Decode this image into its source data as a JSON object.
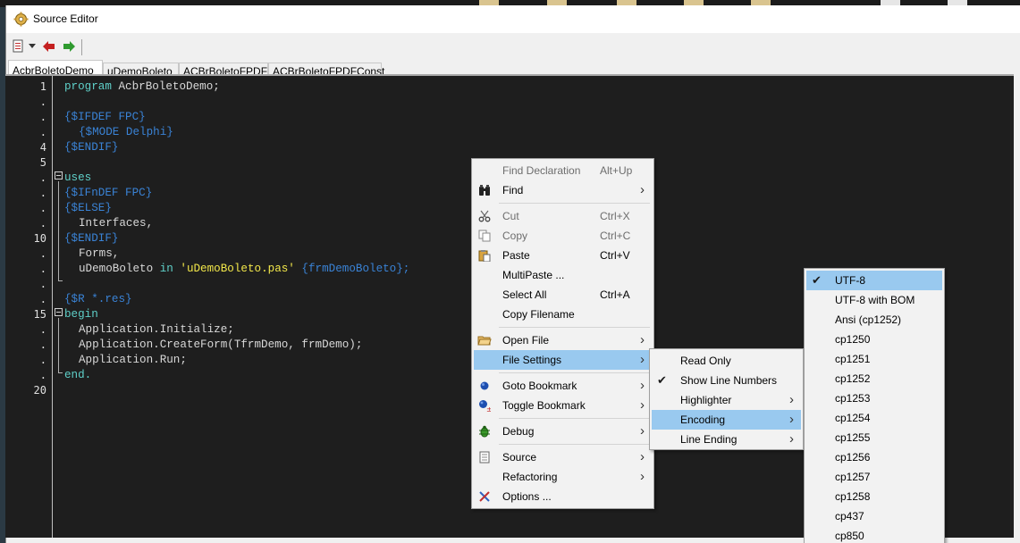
{
  "window": {
    "title": "Source Editor",
    "title_icon": "gear-app-icon"
  },
  "toolbar": {
    "icons": [
      "list-dropdown-icon",
      "back-arrow-icon",
      "forward-arrow-icon"
    ]
  },
  "tabs": [
    {
      "label": "AcbrBoletoDemo",
      "active": true
    },
    {
      "label": "uDemoBoleto",
      "active": false
    },
    {
      "label": "ACBrBoletoFPDF",
      "active": false
    },
    {
      "label": "ACBrBoletoFPDFConst",
      "active": false
    }
  ],
  "gutter": [
    "1",
    ".",
    ".",
    ".",
    "4",
    "5",
    ".",
    ".",
    ".",
    ".",
    "10",
    ".",
    ".",
    ".",
    ".",
    "15",
    ".",
    ".",
    ".",
    ".",
    "20"
  ],
  "code": {
    "line1": {
      "kw": "program",
      "rest": " AcbrBoletoDemo;"
    },
    "line3": "{$IFDEF FPC}",
    "line4": "{$MODE Delphi}",
    "line5": "{$ENDIF}",
    "line7": "uses",
    "line8": "{$IFnDEF FPC}",
    "line9": "{$ELSE}",
    "line10": "Interfaces,",
    "line11": "{$ENDIF}",
    "line12": "Forms,",
    "line13": {
      "a": "uDemoBoleto ",
      "kw": "in",
      "str": " 'uDemoBoleto.pas'",
      "dir": " {frmDemoBoleto};"
    },
    "line15": "{$R *.res}",
    "line16": "begin",
    "line17": "Application.Initialize;",
    "line18": "Application.CreateForm(TfrmDemo, frmDemo);",
    "line19": "Application.Run;",
    "line20": "end."
  },
  "context_menu": {
    "items": [
      {
        "label": "Find Declaration",
        "shortcut": "Alt+Up",
        "disabled": true
      },
      {
        "label": "Find",
        "icon": "binoculars-icon",
        "submenu": true
      },
      {
        "label": "Cut",
        "shortcut": "Ctrl+X",
        "icon": "scissors-icon",
        "disabled": true
      },
      {
        "label": "Copy",
        "shortcut": "Ctrl+C",
        "icon": "copy-icon",
        "disabled": true
      },
      {
        "label": "Paste",
        "shortcut": "Ctrl+V",
        "icon": "paste-icon"
      },
      {
        "label": "MultiPaste ..."
      },
      {
        "label": "Select All",
        "shortcut": "Ctrl+A"
      },
      {
        "label": "Copy Filename"
      },
      {
        "label": "Open File",
        "icon": "open-folder-icon",
        "submenu": true
      },
      {
        "label": "File Settings",
        "submenu": true,
        "highlighted": true
      },
      {
        "label": "Goto Bookmark",
        "icon": "bookmark-icon",
        "submenu": true
      },
      {
        "label": "Toggle Bookmark",
        "icon": "toggle-bookmark-icon",
        "submenu": true
      },
      {
        "label": "Debug",
        "icon": "bug-icon",
        "submenu": true
      },
      {
        "label": "Source",
        "icon": "document-icon",
        "submenu": true
      },
      {
        "label": "Refactoring",
        "submenu": true
      },
      {
        "label": "Options ...",
        "icon": "tools-icon"
      }
    ]
  },
  "file_settings_menu": {
    "items": [
      {
        "label": "Read Only"
      },
      {
        "label": "Show Line Numbers",
        "checked": true
      },
      {
        "label": "Highlighter",
        "submenu": true
      },
      {
        "label": "Encoding",
        "submenu": true,
        "highlighted": true
      },
      {
        "label": "Line Ending",
        "submenu": true
      }
    ]
  },
  "encoding_menu": {
    "items": [
      {
        "label": "UTF-8",
        "checked": true,
        "highlighted": true
      },
      {
        "label": "UTF-8 with BOM"
      },
      {
        "label": "Ansi (cp1252)"
      },
      {
        "label": "cp1250"
      },
      {
        "label": "cp1251"
      },
      {
        "label": "cp1252"
      },
      {
        "label": "cp1253"
      },
      {
        "label": "cp1254"
      },
      {
        "label": "cp1255"
      },
      {
        "label": "cp1256"
      },
      {
        "label": "cp1257"
      },
      {
        "label": "cp1258"
      },
      {
        "label": "cp437"
      },
      {
        "label": "cp850"
      }
    ]
  },
  "colors": {
    "editor_bg": "#1e1e1e",
    "keyword": "#5fd0c9",
    "directive": "#3a83d6",
    "string": "#f2e74a",
    "menu_highlight": "#99c9ef"
  }
}
